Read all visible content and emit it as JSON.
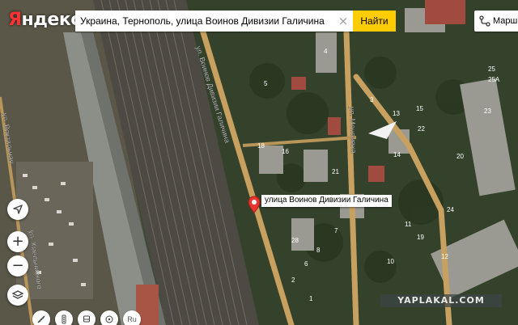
{
  "header": {
    "logo_text": "Яндекс",
    "logo_first_letter": "Я",
    "logo_rest": "ндекс"
  },
  "search": {
    "value": "Украина, Тернополь, улица Воинов Дивизии Галичина",
    "clear_glyph": "×",
    "button_label": "Найти"
  },
  "route": {
    "label": "Марш"
  },
  "map": {
    "type": "satellite",
    "pin": {
      "icon": "map-pin-icon",
      "color": "#e8352f",
      "label": "улица Воинов Дивизии Галичина"
    },
    "street_labels": [
      "ул. Воинов Дивизии Галичина",
      "ул. Мономаха",
      "ул. Хмельницкого",
      "ул. Вокзальная"
    ],
    "house_numbers": [
      "5",
      "4",
      "18",
      "16",
      "21",
      "22",
      "3",
      "24",
      "25",
      "10",
      "14",
      "15",
      "8",
      "7",
      "6",
      "2",
      "1",
      "25А",
      "19",
      "23",
      "20",
      "13",
      "11",
      "12",
      "28"
    ]
  },
  "controls": {
    "locate_icon": "navigation-arrow-icon",
    "zoom_in": "+",
    "zoom_out": "−",
    "layers_icon": "layers-icon",
    "ruler_icon": "ruler-icon",
    "traffic_icon": "traffic-light-icon",
    "transport_icon": "bus-icon",
    "panorama_icon": "panorama-icon",
    "lang_label": "Ru"
  },
  "watermark": "YAPLAKAL.COM",
  "colors": {
    "accent": "#ffcc00",
    "road": "#c8a060",
    "pin": "#e8352f"
  }
}
